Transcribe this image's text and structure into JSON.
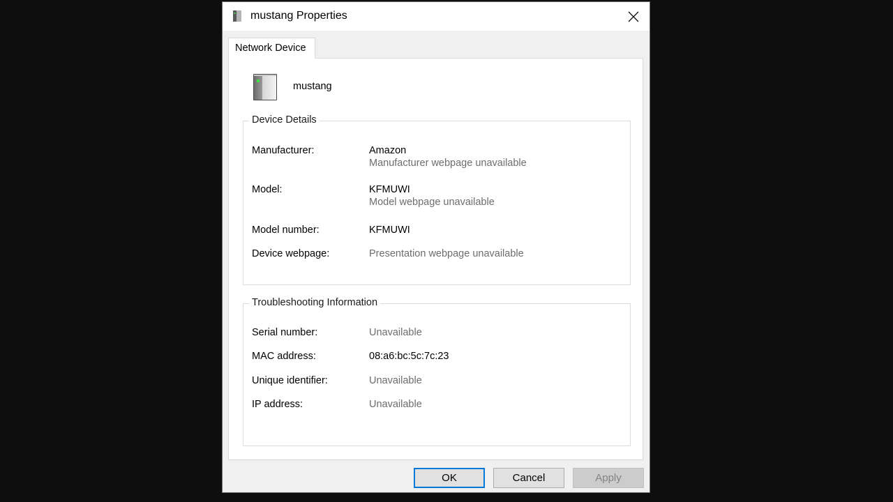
{
  "window": {
    "title": "mustang Properties"
  },
  "tab": {
    "label": "Network Device"
  },
  "device": {
    "name": "mustang"
  },
  "device_details": {
    "legend": "Device Details",
    "manufacturer_label": "Manufacturer:",
    "manufacturer_value": "Amazon",
    "manufacturer_sub": "Manufacturer webpage unavailable",
    "model_label": "Model:",
    "model_value": "KFMUWI",
    "model_sub": "Model webpage unavailable",
    "model_number_label": "Model number:",
    "model_number_value": "KFMUWI",
    "webpage_label": "Device webpage:",
    "webpage_value": "Presentation webpage unavailable"
  },
  "troubleshooting": {
    "legend": "Troubleshooting Information",
    "serial_label": "Serial number:",
    "serial_value": "Unavailable",
    "mac_label": "MAC address:",
    "mac_value": "08:a6:bc:5c:7c:23",
    "uid_label": "Unique identifier:",
    "uid_value": "Unavailable",
    "ip_label": "IP address:",
    "ip_value": "Unavailable"
  },
  "buttons": {
    "ok": "OK",
    "cancel": "Cancel",
    "apply": "Apply"
  },
  "icons": {
    "title": "network-device-icon",
    "close": "close-icon",
    "device": "network-device-icon"
  },
  "colors": {
    "accent": "#0078d7",
    "disabled_text": "#838383",
    "grey_text": "#6d6d6d"
  }
}
